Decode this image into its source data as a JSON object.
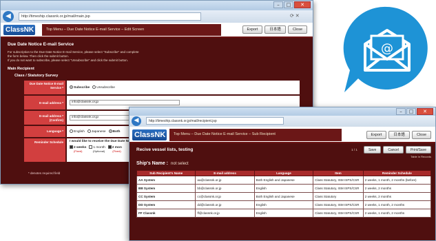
{
  "back_window": {
    "url": "http://timeship.classnk.or.jp/mail/main.jsp",
    "logo": "ClassNK",
    "nav": "Top Menu  –  Due Date Notice E-mail Service  –  Edit Screen",
    "buttons": [
      "Export",
      "日本語",
      "Close"
    ],
    "title": "Due Date Notice E-mail Service",
    "description": [
      "For subscription to the Due Date Notice E-mail Service, please select \"Subscribe\" and complete",
      "the form below. Then click the submit button.",
      "If you do not want to subscribe, please select \"Unsubscribe\" and click the submit button."
    ],
    "section": "Main Recipient",
    "subsection": "Class / Statutory Survey",
    "form": {
      "service_label": "Due Date Notice E-mail Service *",
      "subscribe": "Subscribe",
      "unsubscribe": "Unsubscribe",
      "email_label": "E-mail address *",
      "email_value": "info@classnk.or.jp",
      "email_confirm_label": "E-mail address * (Confirm)",
      "email_confirm_value": "info@classnk.or.jp",
      "language_label": "Language *",
      "lang_english": "English",
      "lang_japanese": "Japanese",
      "lang_both": "Both",
      "schedule_label": "Reminder Schedule",
      "schedule_text": "I would like to receive the Due Date Notice E-mail for \"Class / Statutory Survey\" becoming due in:",
      "opt_2weeks": "2 weeks",
      "opt_2weeks_sub": "(Fixed)",
      "opt_1month": "1 month",
      "opt_1month_sub": "(Optional)",
      "opt_2months": "2 mon",
      "opt_2months_sub": "(Fixed)"
    },
    "required_note": "* denotes required field"
  },
  "front_window": {
    "url": "http://timeship.classnk.or.jp/mail/recipient.jsp",
    "logo": "ClassNK",
    "nav": "Top Menu  –  Due Date Notice E-mail Service  –  Sub Recipient",
    "buttons": [
      "Export",
      "日本語",
      "Close"
    ],
    "title": "Recive vessel lists, testing",
    "paging": "1 / 1",
    "ctrl_buttons": [
      "Save",
      "Cancel",
      "Print/Save"
    ],
    "link": "Table in Records",
    "ship_label": "Ship's Name :",
    "ship_value": "not select",
    "columns": [
      "Sub Recipient's Name",
      "E-mail address",
      "Language",
      "Item",
      "Reminder Schedule"
    ],
    "rows": [
      [
        "AA System",
        "aa@classnk.or.jp",
        "Both English and Japanese",
        "Class Statutory, ISM ISPS/CSR",
        "2 weeks, 1 month, 2 months (before)"
      ],
      [
        "BB System",
        "bb@classnk.or.jp",
        "English",
        "Class Statutory, ISM ISPS/CSR",
        "2 weeks, 2 months"
      ],
      [
        "CC System",
        "cc@classnk.or.jp",
        "Both English and Japanese",
        "Class Statutory",
        "2 weeks, 2 months"
      ],
      [
        "DD System",
        "dd@classnk.or.jp",
        "English",
        "Class Statutory, ISM ISPS/CSR",
        "2 weeks, 1 month, 2 months"
      ],
      [
        "FF Classnk",
        "ff@classnk.or.jp",
        "English",
        "Class Statutory, ISM ISPS/CSR",
        "2 weeks, 1 month, 2 months"
      ]
    ]
  },
  "colors": {
    "brand": "#164a93",
    "page_bg": "#4f0f0f",
    "header_red": "#a82b2b",
    "bubble": "#1e93d6"
  },
  "icons": {
    "mail": "envelope-at-icon",
    "back": "back-arrow-icon"
  }
}
